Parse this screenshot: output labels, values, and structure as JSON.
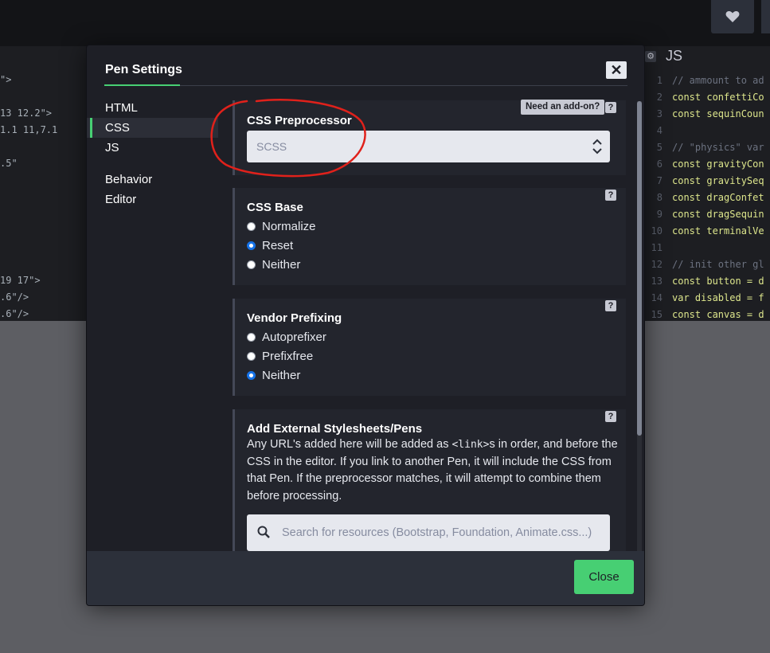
{
  "background": {
    "left_code": [
      "\">",
      "",
      "13 12.2\">",
      "1.1 11,7.1",
      "",
      ".5\"",
      "",
      "",
      "",
      "",
      "",
      "",
      "19 17\">",
      ".6\"/>",
      ".6\"/>"
    ],
    "js_title": "JS",
    "js_line_numbers": [
      "1",
      "2",
      "3",
      "4",
      "5",
      "6",
      "7",
      "8",
      "9",
      "10",
      "11",
      "12",
      "13",
      "14",
      "15"
    ],
    "js_lines": [
      {
        "cls": "cm",
        "text": "// ammount to ad"
      },
      {
        "cls": "kw",
        "text": "const confettiCo"
      },
      {
        "cls": "kw",
        "text": "const sequinCoun"
      },
      {
        "cls": "",
        "text": ""
      },
      {
        "cls": "cm",
        "text": "// \"physics\" var"
      },
      {
        "cls": "kw",
        "text": "const gravityCon"
      },
      {
        "cls": "kw",
        "text": "const gravitySeq"
      },
      {
        "cls": "kw",
        "text": "const dragConfet"
      },
      {
        "cls": "kw",
        "text": "const dragSequin"
      },
      {
        "cls": "kw",
        "text": "const terminalVe"
      },
      {
        "cls": "",
        "text": ""
      },
      {
        "cls": "cm",
        "text": "// init other gl"
      },
      {
        "cls": "kw",
        "text": "const button = d"
      },
      {
        "cls": "kw",
        "text": "var disabled = f"
      },
      {
        "cls": "kw",
        "text": "const canvas = d"
      }
    ]
  },
  "modal": {
    "title": "Pen Settings",
    "close_symbol": "✕",
    "nav": [
      "HTML",
      "CSS",
      "JS",
      "Behavior",
      "Editor"
    ],
    "active_nav": "CSS",
    "preprocessor": {
      "title": "CSS Preprocessor",
      "addon_label": "Need an add-on?",
      "selected": "SCSS"
    },
    "base": {
      "title": "CSS Base",
      "options": [
        "Normalize",
        "Reset",
        "Neither"
      ],
      "selected": "Reset"
    },
    "vendor": {
      "title": "Vendor Prefixing",
      "options": [
        "Autoprefixer",
        "Prefixfree",
        "Neither"
      ],
      "selected": "Neither"
    },
    "external": {
      "title": "Add External Stylesheets/Pens",
      "desc_before": "Any URL's added here will be added as ",
      "desc_code": "<link>",
      "desc_after": "s in order, and before the CSS in the editor. If you link to another Pen, it will include the CSS from that Pen. If the preprocessor matches, it will attempt to combine them before processing.",
      "search_placeholder": "Search for resources (Bootstrap, Foundation, Animate.css...)"
    },
    "help_symbol": "?",
    "close_button": "Close"
  },
  "colors": {
    "accent": "#47cf73",
    "radio_checked": "#1572e8",
    "annotation": "#e0211b"
  }
}
